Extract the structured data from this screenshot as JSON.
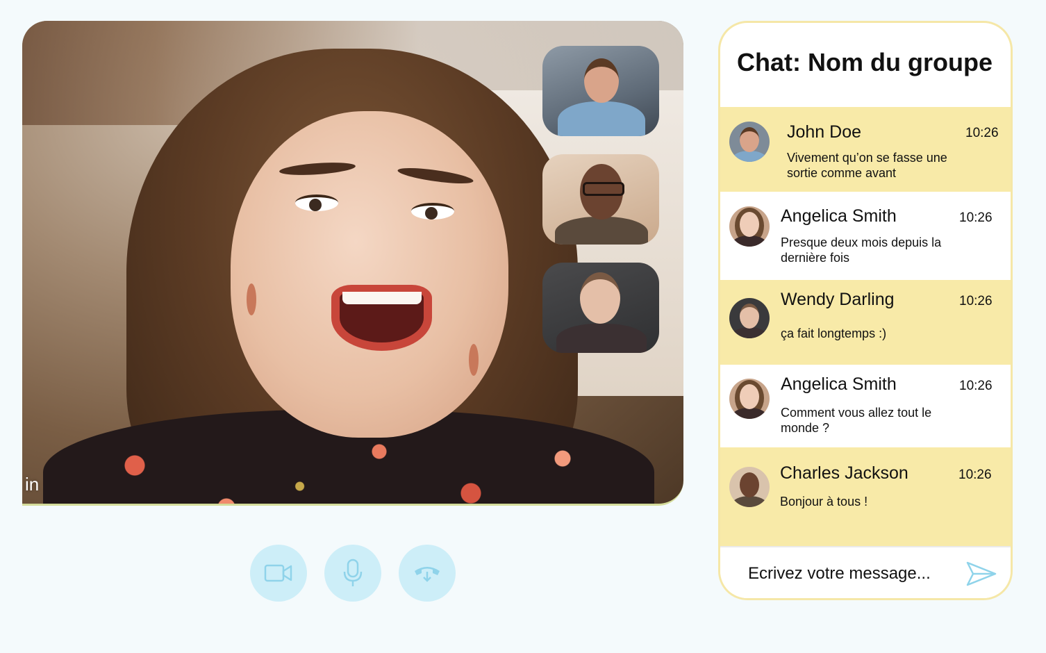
{
  "main_video": {
    "overlay_text": "in"
  },
  "controls": {
    "video_icon": "video-camera-icon",
    "mic_icon": "microphone-icon",
    "hangup_icon": "hang-up-phone-icon",
    "accent": "#cdeef8",
    "icon_color": "#8fd3ea"
  },
  "chat": {
    "title": "Chat: Nom du groupe",
    "border_color": "#f5e7a7",
    "highlight_color": "#f8eaa8",
    "messages": [
      {
        "name": "John Doe",
        "time": "10:26",
        "text": "Vivement qu’on se fasse une sortie comme avant"
      },
      {
        "name": "Angelica Smith",
        "time": "10:26",
        "text": "Presque deux mois depuis la dernière fois"
      },
      {
        "name": "Wendy Darling",
        "time": "10:26",
        "text": "ça fait longtemps :)"
      },
      {
        "name": "Angelica Smith",
        "time": "10:26",
        "text": "Comment vous allez tout le monde ?"
      },
      {
        "name": "Charles Jackson",
        "time": "10:26",
        "text": "Bonjour à tous !"
      }
    ],
    "composer": {
      "placeholder": "Ecrivez votre message...",
      "send_icon": "send-icon"
    }
  }
}
